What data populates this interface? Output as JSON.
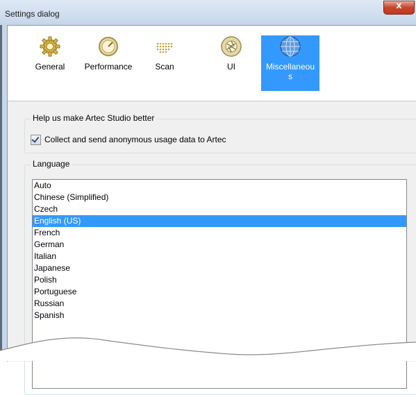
{
  "window": {
    "title": "Settings dialog",
    "close_glyph": "x"
  },
  "toolbar": {
    "items": [
      {
        "label": "General",
        "icon": "gear-icon"
      },
      {
        "label": "Performance",
        "icon": "speedometer-icon"
      },
      {
        "label": "Scan",
        "icon": "dot-grid-icon"
      },
      {
        "label": "UI",
        "icon": "aperture-icon"
      },
      {
        "label": "Miscellaneous",
        "icon": "globe-icon",
        "selected": true
      }
    ],
    "selected_label_line1": "Miscellaneou",
    "selected_label_line2": "s"
  },
  "feedback": {
    "title": "Help us make Artec Studio better",
    "checkbox_label": "Collect and send anonymous usage data to Artec",
    "checked": true
  },
  "language": {
    "title": "Language",
    "options": [
      "Auto",
      "Chinese (Simplified)",
      "Czech",
      "English (US)",
      "French",
      "German",
      "Italian",
      "Japanese",
      "Polish",
      "Portuguese",
      "Russian",
      "Spanish"
    ],
    "selected": "English (US)"
  },
  "colors": {
    "selection": "#3399ff",
    "accent": "#c8452a"
  }
}
